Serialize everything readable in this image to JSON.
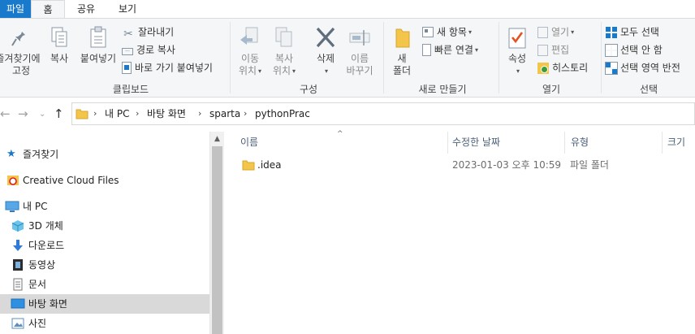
{
  "tabs": {
    "file": "파일",
    "home": "홈",
    "share": "공유",
    "view": "보기"
  },
  "ribbon": {
    "clipboard": {
      "label": "클립보드",
      "pin_line1": "즐겨찾기에",
      "pin_line2": "고정",
      "copy": "복사",
      "paste": "붙여넣기",
      "cut": "잘라내기",
      "copy_path": "경로 복사",
      "paste_shortcut": "바로 가기 붙여넣기"
    },
    "organize": {
      "label": "구성",
      "move_line1": "이동",
      "move_line2": "위치",
      "copyto_line1": "복사",
      "copyto_line2": "위치",
      "delete": "삭제",
      "rename_line1": "이름",
      "rename_line2": "바꾸기"
    },
    "new": {
      "label": "새로 만들기",
      "folder_line1": "새",
      "folder_line2": "폴더",
      "new_item": "새 항목",
      "easy_access": "빠른 연결"
    },
    "open": {
      "label": "열기",
      "properties": "속성",
      "open": "열기",
      "edit": "편집",
      "history": "히스토리"
    },
    "select": {
      "label": "선택",
      "select_all": "모두 선택",
      "select_none": "선택 안 함",
      "invert": "선택 영역 반전"
    }
  },
  "breadcrumb": [
    "내 PC",
    "바탕 화면",
    "sparta",
    "pythonPrac"
  ],
  "navpane": {
    "items": [
      {
        "label": "즐겨찾기",
        "icon": "star-icon"
      },
      {
        "label": "Creative Cloud Files",
        "icon": "creative-cloud-icon"
      },
      {
        "label": "내 PC",
        "icon": "computer-icon"
      },
      {
        "label": "3D 개체",
        "icon": "cube-icon"
      },
      {
        "label": "다운로드",
        "icon": "download-icon"
      },
      {
        "label": "동영상",
        "icon": "video-icon"
      },
      {
        "label": "문서",
        "icon": "document-icon"
      },
      {
        "label": "바탕 화면",
        "icon": "desktop-icon",
        "selected": true
      },
      {
        "label": "사진",
        "icon": "pictures-icon"
      }
    ]
  },
  "columns": {
    "name": "이름",
    "date": "수정한 날짜",
    "type": "유형",
    "size": "크기"
  },
  "files": [
    {
      "name": ".idea",
      "date": "2023-01-03 오후 10:59",
      "type": "파일 폴더",
      "size": ""
    }
  ],
  "colors": {
    "accent": "#1979ca",
    "folder": "#f3c64b",
    "selected_bg": "#d9d9d9",
    "header_text": "#4c607a"
  }
}
